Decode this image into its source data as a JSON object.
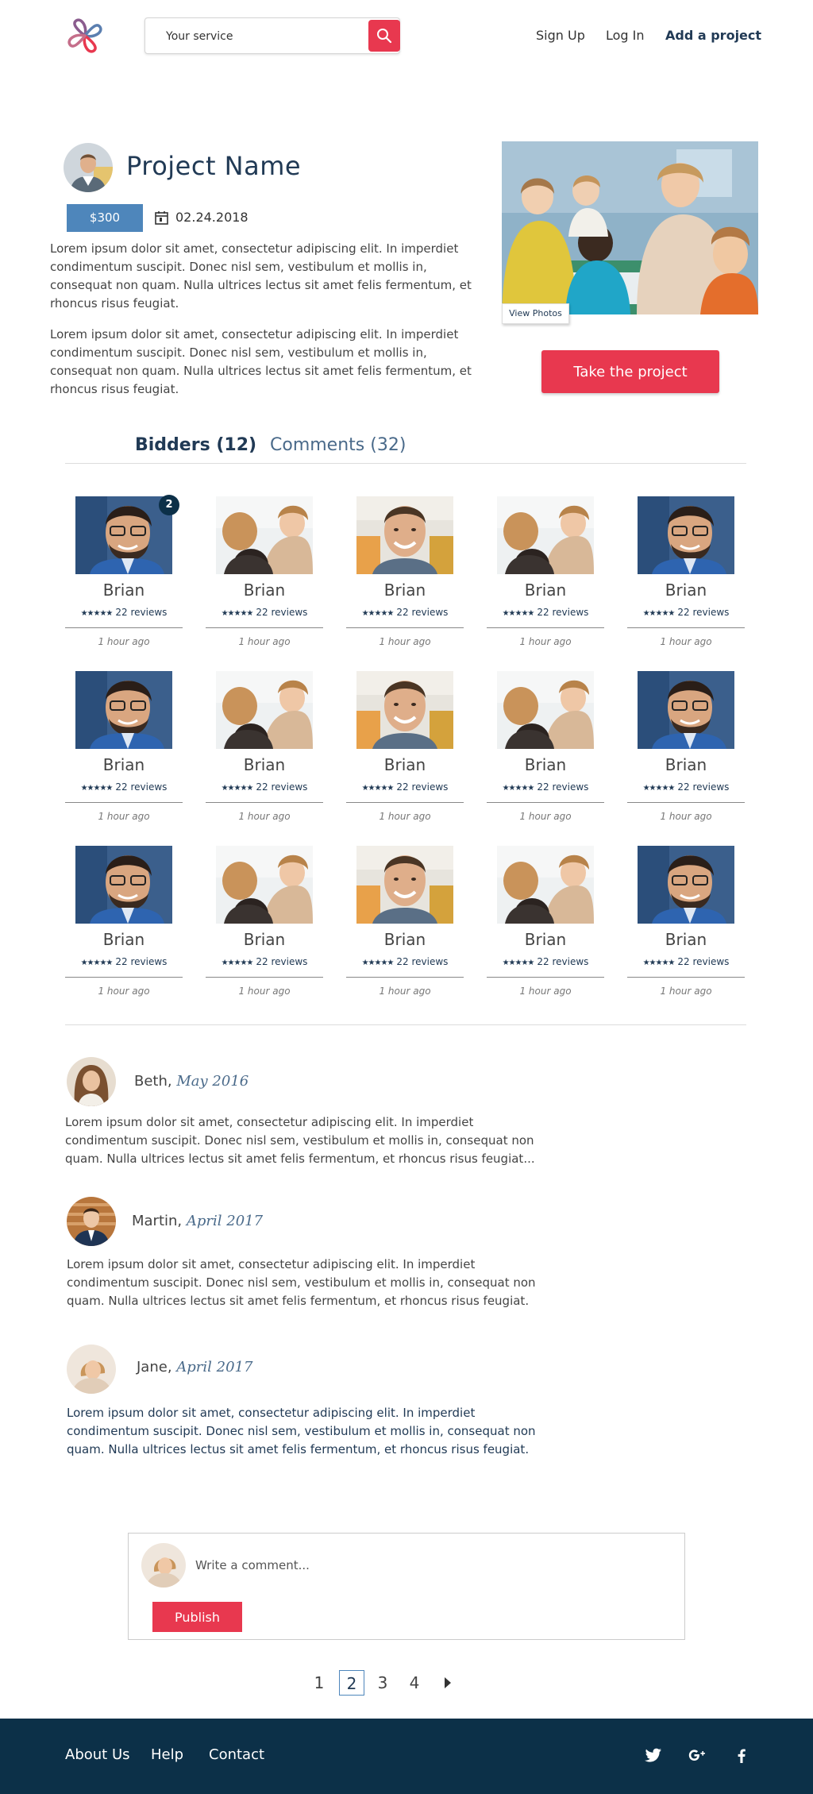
{
  "header": {
    "search_placeholder": "Your service",
    "nav": {
      "signup": "Sign Up",
      "login": "Log In",
      "add_project": "Add a project"
    }
  },
  "project": {
    "name": "Project Name",
    "price": "$300",
    "date": "02.24.2018",
    "description_1": "Lorem ipsum dolor sit amet, consectetur adipiscing elit. In imperdiet condimentum suscipit. Donec nisl sem, vestibulum et mollis in, consequat non quam. Nulla ultrices lectus sit amet felis fermentum, et rhoncus risus feugiat.",
    "description_2": "Lorem ipsum dolor sit amet, consectetur adipiscing elit. In imperdiet condimentum suscipit. Donec nisl sem, vestibulum et mollis in, consequat non quam. Nulla ultrices lectus sit amet felis fermentum, et rhoncus risus feugiat.",
    "view_photos": "View Photos",
    "take_button": "Take the project"
  },
  "tabs": {
    "bidders": "Bidders (12)",
    "comments": "Comments (32)"
  },
  "bidders": {
    "badge": "2",
    "cards": [
      {
        "photo": "man-glasses",
        "name": "Brian",
        "stars": "★★★★★",
        "reviews": "22 reviews",
        "time": "1 hour ago"
      },
      {
        "photo": "woman-kids",
        "name": "Brian",
        "stars": "★★★★★",
        "reviews": "22 reviews",
        "time": "1 hour ago"
      },
      {
        "photo": "man-smile",
        "name": "Brian",
        "stars": "★★★★★",
        "reviews": "22 reviews",
        "time": "1 hour ago"
      },
      {
        "photo": "woman-kids",
        "name": "Brian",
        "stars": "★★★★★",
        "reviews": "22 reviews",
        "time": "1 hour ago"
      },
      {
        "photo": "man-glasses",
        "name": "Brian",
        "stars": "★★★★★",
        "reviews": "22 reviews",
        "time": "1 hour ago"
      },
      {
        "photo": "man-glasses",
        "name": "Brian",
        "stars": "★★★★★",
        "reviews": "22 reviews",
        "time": "1 hour ago"
      },
      {
        "photo": "woman-kids",
        "name": "Brian",
        "stars": "★★★★★",
        "reviews": "22 reviews",
        "time": "1 hour ago"
      },
      {
        "photo": "man-smile",
        "name": "Brian",
        "stars": "★★★★★",
        "reviews": "22 reviews",
        "time": "1 hour ago"
      },
      {
        "photo": "woman-kids",
        "name": "Brian",
        "stars": "★★★★★",
        "reviews": "22 reviews",
        "time": "1 hour ago"
      },
      {
        "photo": "man-glasses",
        "name": "Brian",
        "stars": "★★★★★",
        "reviews": "22 reviews",
        "time": "1 hour ago"
      },
      {
        "photo": "man-glasses",
        "name": "Brian",
        "stars": "★★★★★",
        "reviews": "22 reviews",
        "time": "1 hour ago"
      },
      {
        "photo": "woman-kids",
        "name": "Brian",
        "stars": "★★★★★",
        "reviews": "22 reviews",
        "time": "1 hour ago"
      },
      {
        "photo": "man-smile",
        "name": "Brian",
        "stars": "★★★★★",
        "reviews": "22 reviews",
        "time": "1 hour ago"
      },
      {
        "photo": "woman-kids",
        "name": "Brian",
        "stars": "★★★★★",
        "reviews": "22 reviews",
        "time": "1 hour ago"
      },
      {
        "photo": "man-glasses",
        "name": "Brian",
        "stars": "★★★★★",
        "reviews": "22 reviews",
        "time": "1 hour ago"
      }
    ]
  },
  "comments": [
    {
      "author": "Beth,",
      "when": "May 2016",
      "text": "Lorem ipsum dolor sit amet, consectetur adipiscing elit. In imperdiet condimentum suscipit. Donec nisl sem, vestibulum et mollis in, consequat non quam. Nulla ultrices lectus sit amet felis fermentum, et rhoncus risus feugiat..."
    },
    {
      "author": "Martin,",
      "when": "April 2017",
      "text": "Lorem ipsum dolor sit amet, consectetur adipiscing elit. In imperdiet condimentum suscipit. Donec nisl sem, vestibulum et mollis in, consequat non quam. Nulla ultrices lectus sit amet felis fermentum, et rhoncus risus feugiat."
    },
    {
      "author": "Jane,",
      "when": "April  2017",
      "text": "Lorem ipsum dolor sit amet, consectetur adipiscing elit. In imperdiet condimentum suscipit. Donec nisl sem, vestibulum et mollis in, consequat non quam. Nulla ultrices lectus sit amet felis fermentum, et rhoncus risus feugiat."
    }
  ],
  "write_comment": {
    "placeholder": "Write a comment...",
    "publish": "Publish"
  },
  "pagination": {
    "pages": [
      "1",
      "2",
      "3",
      "4"
    ],
    "active": "2"
  },
  "footer": {
    "about": "About Us",
    "help": "Help",
    "contact": "Contact"
  },
  "colors": {
    "accent": "#e8384f",
    "navy": "#0c3048",
    "price_blue": "#4e86bb",
    "heading": "#213a55"
  }
}
